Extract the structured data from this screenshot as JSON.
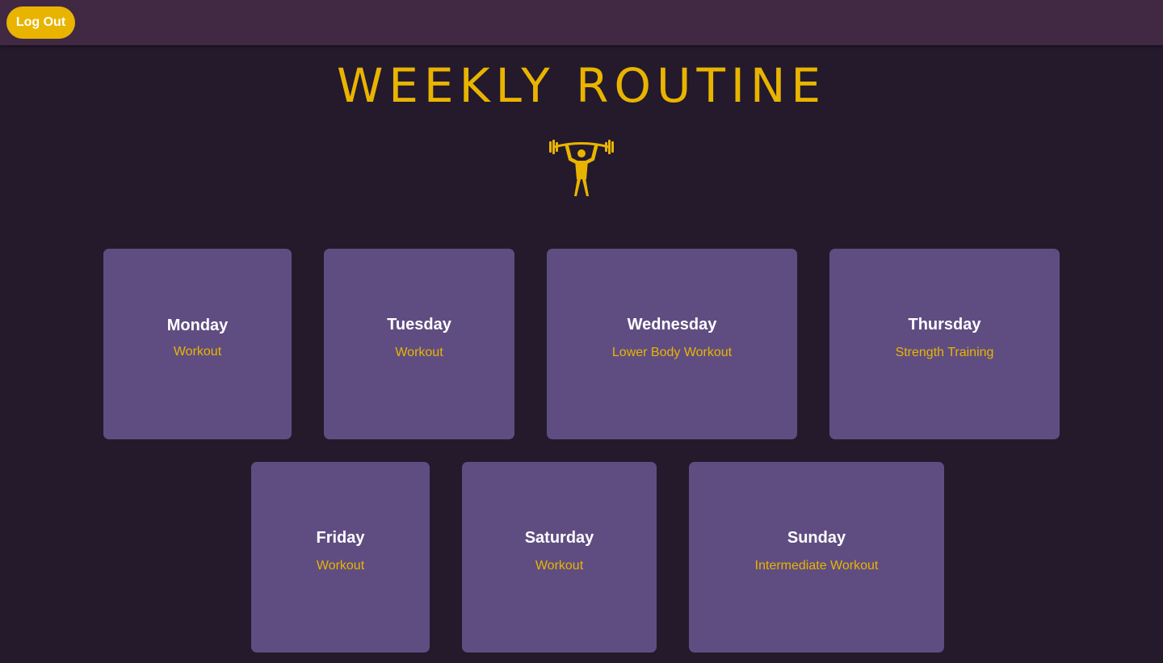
{
  "header": {
    "logout_label": "Log Out"
  },
  "main": {
    "title": "WEEKLY ROUTINE",
    "hero_icon": "weightlifter-icon",
    "days": [
      {
        "day": "Monday",
        "workout": "Workout"
      },
      {
        "day": "Tuesday",
        "workout": "Workout"
      },
      {
        "day": "Wednesday",
        "workout": "Lower Body Workout"
      },
      {
        "day": "Thursday",
        "workout": "Strength Training"
      },
      {
        "day": "Friday",
        "workout": "Workout"
      },
      {
        "day": "Saturday",
        "workout": "Workout"
      },
      {
        "day": "Sunday",
        "workout": "Intermediate Workout"
      }
    ]
  },
  "colors": {
    "background": "#241a2c",
    "topbar": "#412843",
    "accent": "#e9b400",
    "card": "#5f4d82",
    "text": "#ffffff"
  }
}
